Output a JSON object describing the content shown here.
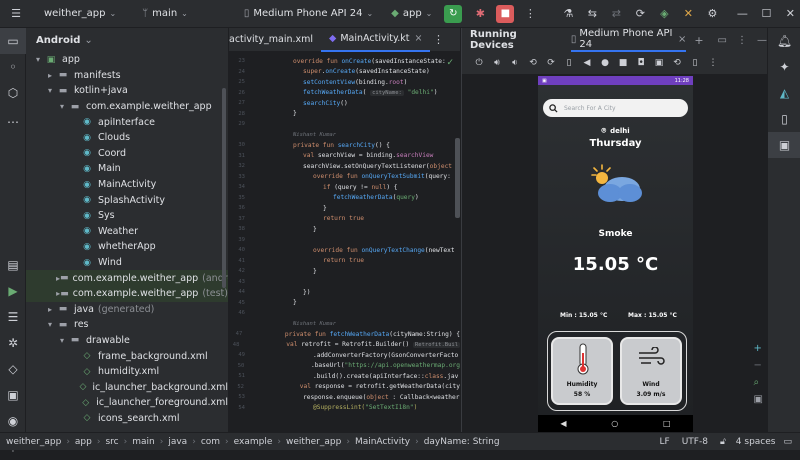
{
  "toolbar": {
    "project": "weither_app",
    "branch": "main",
    "device": "Medium Phone API 24",
    "run_config": "app"
  },
  "project_panel": {
    "title": "Android",
    "items": [
      {
        "label": "app",
        "depth": 0,
        "arrow": "▾",
        "icon": "▣"
      },
      {
        "label": "manifests",
        "depth": 1,
        "arrow": "▸",
        "icon": "▬"
      },
      {
        "label": "kotlin+java",
        "depth": 1,
        "arrow": "▾",
        "icon": "▬"
      },
      {
        "label": "com.example.weither_app",
        "depth": 2,
        "arrow": "▾",
        "icon": "▬"
      },
      {
        "label": "apiInterface",
        "depth": 3,
        "arrow": "",
        "icon": "◉"
      },
      {
        "label": "Clouds",
        "depth": 3,
        "arrow": "",
        "icon": "◉"
      },
      {
        "label": "Coord",
        "depth": 3,
        "arrow": "",
        "icon": "◉"
      },
      {
        "label": "Main",
        "depth": 3,
        "arrow": "",
        "icon": "◉"
      },
      {
        "label": "MainActivity",
        "depth": 3,
        "arrow": "",
        "icon": "◉"
      },
      {
        "label": "SplashActivity",
        "depth": 3,
        "arrow": "",
        "icon": "◉"
      },
      {
        "label": "Sys",
        "depth": 3,
        "arrow": "",
        "icon": "◉"
      },
      {
        "label": "Weather",
        "depth": 3,
        "arrow": "",
        "icon": "◉"
      },
      {
        "label": "whetherApp",
        "depth": 3,
        "arrow": "",
        "icon": "◉"
      },
      {
        "label": "Wind",
        "depth": 3,
        "arrow": "",
        "icon": "◉"
      },
      {
        "label": "com.example.weither_app",
        "suffix": "(androidT",
        "depth": 2,
        "arrow": "▸",
        "icon": "▬",
        "selected": true
      },
      {
        "label": "com.example.weither_app",
        "suffix": "(test)",
        "depth": 2,
        "arrow": "▸",
        "icon": "▬",
        "selected": true
      },
      {
        "label": "java",
        "suffix": "(generated)",
        "depth": 1,
        "arrow": "▸",
        "icon": "▬"
      },
      {
        "label": "res",
        "depth": 1,
        "arrow": "▾",
        "icon": "▬"
      },
      {
        "label": "drawable",
        "depth": 2,
        "arrow": "▾",
        "icon": "▬"
      },
      {
        "label": "frame_background.xml",
        "depth": 3,
        "arrow": "",
        "icon": "◇"
      },
      {
        "label": "humidity.xml",
        "depth": 3,
        "arrow": "",
        "icon": "◇"
      },
      {
        "label": "ic_launcher_background.xml",
        "depth": 3,
        "arrow": "",
        "icon": "◇"
      },
      {
        "label": "ic_launcher_foreground.xml",
        "depth": 3,
        "arrow": "",
        "icon": "◇"
      },
      {
        "label": "icons_search.xml",
        "depth": 3,
        "arrow": "",
        "icon": "◇"
      }
    ]
  },
  "editor": {
    "tab_inactive": "activity_main.xml",
    "tab_active": "MainActivity.kt",
    "lines": [
      {
        "n": "23",
        "parts": [
          [
            "kw",
            "override fun "
          ],
          [
            "fn",
            "onCreate"
          ],
          [
            "",
            "(savedInstanceState:"
          ]
        ],
        "indent": 1
      },
      {
        "n": "24",
        "parts": [
          [
            "kw",
            "super"
          ],
          [
            "",
            "."
          ],
          [
            "fn",
            "onCreate"
          ],
          [
            "",
            "(savedInstanceState)"
          ]
        ],
        "indent": 2
      },
      {
        "n": "25",
        "parts": [
          [
            "fn",
            "setContentView"
          ],
          [
            "",
            "(binding."
          ],
          [
            "prop",
            "root"
          ],
          [
            "",
            ")"
          ]
        ],
        "indent": 2
      },
      {
        "n": "26",
        "parts": [
          [
            "fn",
            "fetchWeatherData"
          ],
          [
            "",
            "( "
          ],
          [
            "hint",
            "cityName:"
          ],
          [
            "str",
            " \"delhi\""
          ],
          [
            "",
            ")"
          ]
        ],
        "indent": 2
      },
      {
        "n": "27",
        "parts": [
          [
            "fn",
            "searchCity"
          ],
          [
            "",
            "()"
          ]
        ],
        "indent": 2
      },
      {
        "n": "28",
        "parts": [
          [
            "",
            "}"
          ]
        ],
        "indent": 1
      },
      {
        "n": "29",
        "parts": [],
        "indent": 0
      },
      {
        "n": "",
        "parts": [
          [
            "author",
            "Nishant Kumar"
          ]
        ],
        "indent": 1
      },
      {
        "n": "30",
        "parts": [
          [
            "kw",
            "private fun "
          ],
          [
            "fn",
            "searchCity"
          ],
          [
            "",
            "() {"
          ]
        ],
        "indent": 1
      },
      {
        "n": "31",
        "parts": [
          [
            "kw",
            "val "
          ],
          [
            "",
            "searchView = binding."
          ],
          [
            "prop",
            "searchView"
          ]
        ],
        "indent": 2
      },
      {
        "n": "32",
        "parts": [
          [
            "",
            "searchView.setOnQueryTextListener("
          ],
          [
            "kw",
            "object"
          ],
          [
            "",
            " :"
          ]
        ],
        "indent": 2
      },
      {
        "n": "33",
        "parts": [
          [
            "kw",
            "override fun "
          ],
          [
            "fn",
            "onQueryTextSubmit"
          ],
          [
            "",
            "(query: S"
          ]
        ],
        "indent": 3
      },
      {
        "n": "34",
        "parts": [
          [
            "kw",
            "if "
          ],
          [
            "",
            "(query != "
          ],
          [
            "kw",
            "null"
          ],
          [
            "",
            ") {"
          ]
        ],
        "indent": 4
      },
      {
        "n": "35",
        "parts": [
          [
            "fn",
            "fetchWeatherData"
          ],
          [
            "",
            "("
          ],
          [
            "str",
            "query"
          ],
          [
            "",
            ")"
          ]
        ],
        "indent": 5
      },
      {
        "n": "36",
        "parts": [
          [
            "",
            "}"
          ]
        ],
        "indent": 4
      },
      {
        "n": "37",
        "parts": [
          [
            "kw",
            "return true"
          ]
        ],
        "indent": 4
      },
      {
        "n": "38",
        "parts": [
          [
            "",
            "}"
          ]
        ],
        "indent": 3
      },
      {
        "n": "39",
        "parts": [],
        "indent": 0
      },
      {
        "n": "40",
        "parts": [
          [
            "kw",
            "override fun "
          ],
          [
            "fn",
            "onQueryTextChange"
          ],
          [
            "",
            "(newText"
          ]
        ],
        "indent": 3
      },
      {
        "n": "41",
        "parts": [
          [
            "kw",
            "return true"
          ]
        ],
        "indent": 4
      },
      {
        "n": "42",
        "parts": [
          [
            "",
            "}"
          ]
        ],
        "indent": 3
      },
      {
        "n": "43",
        "parts": [],
        "indent": 0
      },
      {
        "n": "44",
        "parts": [
          [
            "",
            "})"
          ]
        ],
        "indent": 2
      },
      {
        "n": "45",
        "parts": [
          [
            "",
            "}"
          ]
        ],
        "indent": 1
      },
      {
        "n": "46",
        "parts": [],
        "indent": 0
      },
      {
        "n": "",
        "parts": [
          [
            "author",
            "Nishant Kumar"
          ]
        ],
        "indent": 1
      },
      {
        "n": "47",
        "parts": [
          [
            "kw",
            "private fun "
          ],
          [
            "fn",
            "fetchWeatherData"
          ],
          [
            "",
            "(cityName:String) {"
          ]
        ],
        "indent": 1
      },
      {
        "n": "48",
        "parts": [
          [
            "kw",
            "val "
          ],
          [
            "",
            "retrofit = Retrofit.Builder() "
          ],
          [
            "hint",
            "Retrofit.Buil"
          ]
        ],
        "indent": 2
      },
      {
        "n": "49",
        "parts": [
          [
            "",
            ".addConverterFactory(GsonConverterFacto"
          ]
        ],
        "indent": 3
      },
      {
        "n": "50",
        "parts": [
          [
            "",
            ".baseUrl("
          ],
          [
            "str",
            "\"https://api.openweathermap.org"
          ]
        ],
        "indent": 3
      },
      {
        "n": "51",
        "parts": [
          [
            "",
            ".build().create(apiInterface::"
          ],
          [
            "kw",
            "class"
          ],
          [
            "",
            ".jav"
          ]
        ],
        "indent": 3
      },
      {
        "n": "52",
        "parts": [
          [
            "kw",
            "val "
          ],
          [
            "",
            "response = retrofit.getWeatherData(city"
          ]
        ],
        "indent": 2
      },
      {
        "n": "53",
        "parts": [
          [
            "",
            "response.enqueue("
          ],
          [
            "kw",
            "object"
          ],
          [
            "",
            " : Callback<weather"
          ]
        ],
        "indent": 2
      },
      {
        "n": "54",
        "parts": [
          [
            "ann",
            "@SuppressLint("
          ],
          [
            "str",
            "\"SetTextI18n\""
          ],
          [
            "ann",
            ")"
          ]
        ],
        "indent": 3
      }
    ]
  },
  "running_devices": {
    "title": "Running Devices",
    "device_tab": "Medium Phone API 24"
  },
  "phone": {
    "status_time": "11:28",
    "search_placeholder": "Search For A City",
    "city": "delhi",
    "day": "Thursday",
    "condition": "Smoke",
    "temperature": "15.05 °C",
    "min_temp": "Min : 15.05 °C",
    "max_temp": "Max : 15.05 °C",
    "humidity_label": "Humidity",
    "humidity_value": "58 %",
    "wind_label": "Wind",
    "wind_value": "3.09 m/s"
  },
  "statusbar": {
    "crumbs": [
      "weither_app",
      "app",
      "src",
      "main",
      "java",
      "com",
      "example",
      "weither_app",
      "MainActivity"
    ],
    "crumb_tail": "dayName: String",
    "line_sep": "LF",
    "encoding": "UTF-8",
    "indent": "4 spaces"
  }
}
